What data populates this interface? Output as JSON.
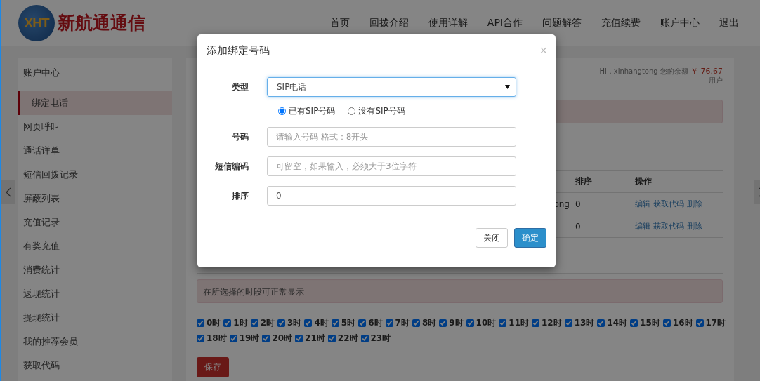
{
  "logo": {
    "mark": "XHT",
    "name": "新航通通信"
  },
  "nav": [
    "首页",
    "回拨介绍",
    "使用详解",
    "API合作",
    "问题解答",
    "充值续费",
    "账户中心",
    "退出"
  ],
  "sidebar": {
    "title": "账户中心",
    "items": [
      {
        "label": "绑定电话",
        "selected": true
      },
      {
        "label": "网页呼叫",
        "selected": false
      },
      {
        "label": "通话详单",
        "selected": false
      },
      {
        "label": "短信回拨记录",
        "selected": false
      },
      {
        "label": "屏蔽列表",
        "selected": false
      },
      {
        "label": "充值记录",
        "selected": false
      },
      {
        "label": "有奖充值",
        "selected": false
      },
      {
        "label": "消费统计",
        "selected": false
      },
      {
        "label": "返现统计",
        "selected": false
      },
      {
        "label": "提现统计",
        "selected": false
      },
      {
        "label": "我的推荐会员",
        "selected": false
      },
      {
        "label": "获取代码",
        "selected": false
      }
    ]
  },
  "account": {
    "greeting": "Hi，xinhangtong 您的余额",
    "balance": "￥ 76.67",
    "role": "用户"
  },
  "table": {
    "columns": [
      "排序",
      "操作"
    ],
    "rows": [
      {
        "column_1": "ong",
        "sort": "0",
        "actions": [
          "编辑",
          "获取代码",
          "删除"
        ]
      },
      {
        "sort": "0",
        "actions": [
          "编辑",
          "获取代码",
          "删除"
        ]
      }
    ]
  },
  "schedule": {
    "notice": "在所选择的时段可正常显示",
    "hours": [
      {
        "label": "0时",
        "checked": true
      },
      {
        "label": "1时",
        "checked": true
      },
      {
        "label": "2时",
        "checked": true
      },
      {
        "label": "3时",
        "checked": true
      },
      {
        "label": "4时",
        "checked": true
      },
      {
        "label": "5时",
        "checked": true
      },
      {
        "label": "6时",
        "checked": true
      },
      {
        "label": "7时",
        "checked": true
      },
      {
        "label": "8时",
        "checked": true
      },
      {
        "label": "9时",
        "checked": true
      },
      {
        "label": "10时",
        "checked": true
      },
      {
        "label": "11时",
        "checked": true
      },
      {
        "label": "12时",
        "checked": true
      },
      {
        "label": "13时",
        "checked": true
      },
      {
        "label": "14时",
        "checked": true
      },
      {
        "label": "15时",
        "checked": true
      },
      {
        "label": "16时",
        "checked": true
      },
      {
        "label": "17时",
        "checked": true
      },
      {
        "label": "18时",
        "checked": true
      },
      {
        "label": "19时",
        "checked": true
      },
      {
        "label": "20时",
        "checked": true
      },
      {
        "label": "21时",
        "checked": true
      },
      {
        "label": "22时",
        "checked": true
      },
      {
        "label": "23时",
        "checked": true
      }
    ],
    "save": "保存"
  },
  "modal": {
    "title": "添加绑定号码",
    "close": "×",
    "type": {
      "label": "类型",
      "value": "SIP电话"
    },
    "radios": [
      {
        "label": "已有SIP号码",
        "selected": true
      },
      {
        "label": "没有SIP号码",
        "selected": false
      }
    ],
    "fields": [
      {
        "label": "号码",
        "placeholder": "请输入号码 格式：8开头"
      },
      {
        "label": "短信编码",
        "placeholder": "可留空，如果输入，必须大于3位字符"
      },
      {
        "label": "排序",
        "value": "0"
      }
    ],
    "buttons": [
      {
        "label": "关闭",
        "kind": "default"
      },
      {
        "label": "确定",
        "kind": "primary"
      }
    ]
  }
}
